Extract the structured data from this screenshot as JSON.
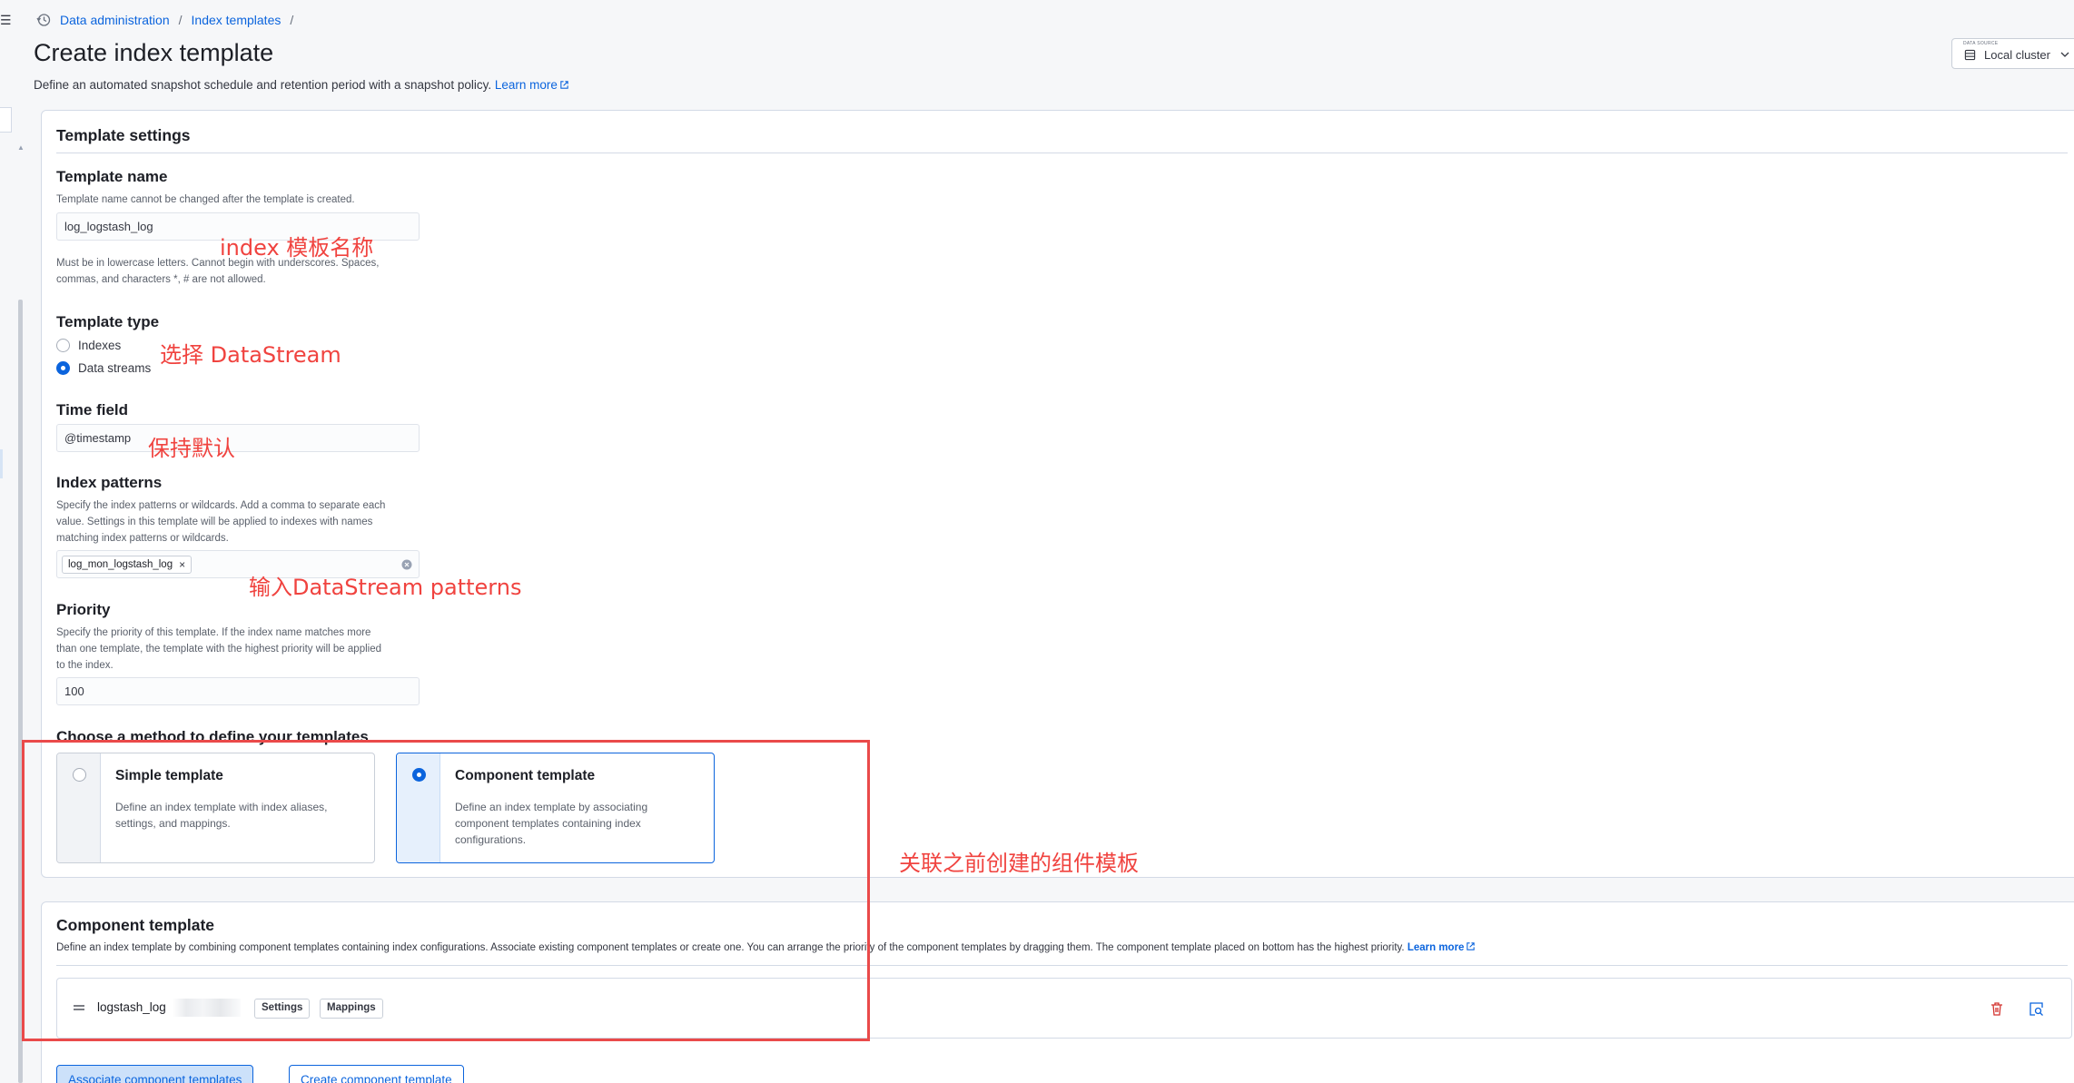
{
  "breadcrumbs": [
    "Data administration",
    "Index templates"
  ],
  "breadcrumb_sep": "/",
  "page": {
    "title": "Create index template",
    "description": "Define an automated snapshot schedule and retention period with a snapshot policy.",
    "learn_more": "Learn more"
  },
  "datasource": {
    "label": "DATA SOURCE",
    "value": "Local cluster"
  },
  "settings": {
    "heading": "Template settings",
    "name_label": "Template name",
    "name_help": "Template name cannot be changed after the template is created.",
    "name_value": "log_logstash_log",
    "name_rule": "Must be in lowercase letters. Cannot begin with underscores. Spaces,",
    "name_rule2": "commas, and characters *, # are not allowed.",
    "type_label": "Template type",
    "type_options": [
      "Indexes",
      "Data streams"
    ],
    "time_label": "Time field",
    "time_value": "@timestamp",
    "patterns_label": "Index patterns",
    "patterns_help1": "Specify the index patterns or wildcards. Add a comma to separate each",
    "patterns_help2": "value. Settings in this template will be applied to indexes with names",
    "patterns_help3": "matching index patterns or wildcards.",
    "pattern_chip": "log_mon_logstash_log",
    "chip_remove": "×",
    "priority_label": "Priority",
    "priority_help1": "Specify the priority of this template. If the index name matches more",
    "priority_help2": "than one template, the template with the highest priority will be applied",
    "priority_help3": "to the index.",
    "priority_value": "100",
    "method_label": "Choose a method to define your templates",
    "simple_title": "Simple template",
    "simple_desc": "Define an index template with index aliases, settings, and mappings.",
    "component_title": "Component template",
    "component_desc": "Define an index template by associating component templates containing index configurations."
  },
  "component": {
    "heading": "Component template",
    "desc": "Define an index template by combining component templates containing index configurations. Associate existing component templates or create one. You can arrange the priority of the component templates by dragging them. The component template placed on bottom has the highest priority.",
    "learn_more": "Learn more",
    "row_name": "logstash_log",
    "badge_settings": "Settings",
    "badge_mappings": "Mappings",
    "associate_btn": "Associate component templates",
    "create_btn": "Create component template"
  },
  "annotations": {
    "a1": "index 模板名称",
    "a2": "选择 DataStream",
    "a3": "保持默认",
    "a4": "输入DataStream patterns",
    "a5": "关联之前创建的组件模板"
  },
  "colors": {
    "accent": "#0b64dd",
    "annotation": "#f0433f"
  }
}
